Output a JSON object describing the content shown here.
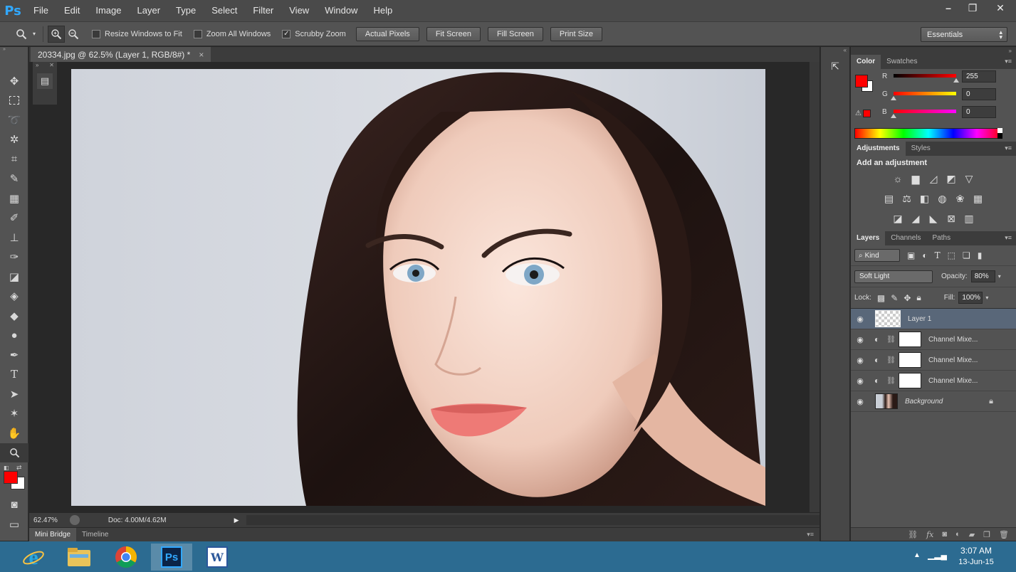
{
  "app": {
    "logo": "Ps"
  },
  "menu": [
    "File",
    "Edit",
    "Image",
    "Layer",
    "Type",
    "Select",
    "Filter",
    "View",
    "Window",
    "Help"
  ],
  "window_controls": {
    "minimize": "–",
    "restore": "❐",
    "close": "✕"
  },
  "options": {
    "resize_windows_to_fit": {
      "label": "Resize Windows to Fit",
      "checked": false
    },
    "zoom_all_windows": {
      "label": "Zoom All Windows",
      "checked": false
    },
    "scrubby_zoom": {
      "label": "Scrubby Zoom",
      "checked": true
    },
    "buttons": [
      "Actual Pixels",
      "Fit Screen",
      "Fill Screen",
      "Print Size"
    ],
    "workspace": "Essentials"
  },
  "document": {
    "tab_title": "20334.jpg @ 62.5% (Layer 1, RGB/8#) *",
    "close": "×",
    "zoom": "62.47%",
    "doc_size": "Doc: 4.00M/4.62M"
  },
  "bottom_tabs": [
    "Mini Bridge",
    "Timeline"
  ],
  "color_panel": {
    "tabs": [
      "Color",
      "Swatches"
    ],
    "r_label": "R",
    "g_label": "G",
    "b_label": "B",
    "r": 255,
    "g": 0,
    "b": 0,
    "r_display": "255",
    "g_display": "0",
    "b_display": "0",
    "foreground": "#ff0000",
    "background": "#ffffff"
  },
  "adjustments_panel": {
    "tabs": [
      "Adjustments",
      "Styles"
    ],
    "heading": "Add an adjustment"
  },
  "layers_panel": {
    "tabs": [
      "Layers",
      "Channels",
      "Paths"
    ],
    "filter_kind": "Kind",
    "blend_mode": "Soft Light",
    "opacity_label": "Opacity:",
    "opacity": "80%",
    "lock_label": "Lock:",
    "fill_label": "Fill:",
    "fill": "100%",
    "layers": [
      {
        "name": "Layer 1",
        "selected": true
      },
      {
        "name": "Channel Mixe..."
      },
      {
        "name": "Channel Mixe..."
      },
      {
        "name": "Channel Mixe..."
      },
      {
        "name": "Background",
        "locked": true
      }
    ]
  },
  "taskbar": {
    "time": "3:07 AM",
    "date": "13-Jun-15"
  }
}
